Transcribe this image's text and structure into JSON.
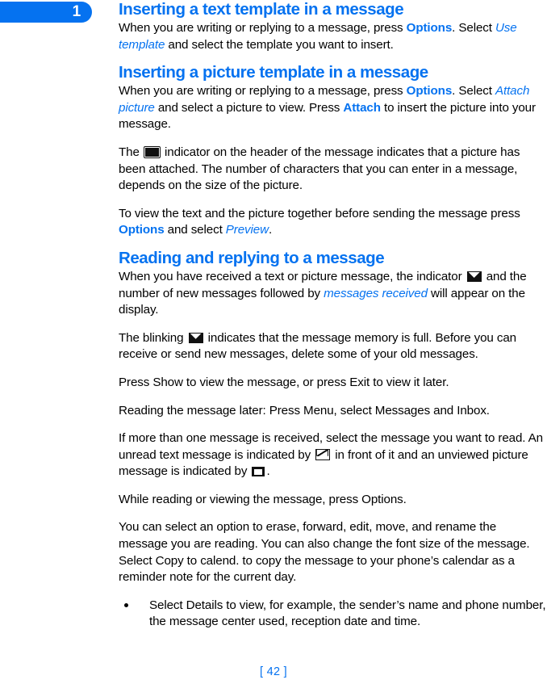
{
  "chapter_tab": {
    "number": "1",
    "color": "#0572f0"
  },
  "theme": {
    "accent": "#0572f0",
    "text": "#000000",
    "background": "#ffffff"
  },
  "sections": [
    {
      "heading": "Inserting a text template in a message",
      "paragraphs": [
        {
          "id": "p1",
          "runs": [
            {
              "text": "When you are writing or replying to a message, press ",
              "style": "plain"
            },
            {
              "text": "Options",
              "style": "blue-bold"
            },
            {
              "text": ". Select ",
              "style": "plain"
            },
            {
              "text": "Use template",
              "style": "blue-italic"
            },
            {
              "text": " and select the template you want to insert.",
              "style": "plain"
            }
          ]
        }
      ]
    },
    {
      "heading": "Inserting a picture template in a message",
      "paragraphs": [
        {
          "id": "p2",
          "runs": [
            {
              "text": "When you are writing or replying to a message, press ",
              "style": "plain"
            },
            {
              "text": "Options",
              "style": "blue-bold"
            },
            {
              "text": ". Select ",
              "style": "plain"
            },
            {
              "text": "Attach picture",
              "style": "blue-italic"
            },
            {
              "text": " and select a picture to view. Press ",
              "style": "plain"
            },
            {
              "text": "Attach",
              "style": "blue-bold"
            },
            {
              "text": " to insert the picture into your message.",
              "style": "plain"
            }
          ]
        },
        {
          "id": "p3",
          "lead": "The ",
          "icon": "picture-attached-icon",
          "tail": " indicator on the header of the message indicates that a picture has been attached. The number of characters that you can enter in a message, depends on the size of the picture."
        },
        {
          "id": "p4",
          "runs": [
            {
              "text": "To view the text and the picture together before sending the message press ",
              "style": "plain"
            },
            {
              "text": "Options",
              "style": "blue-bold"
            },
            {
              "text": " and select ",
              "style": "plain"
            },
            {
              "text": "Preview",
              "style": "blue-italic"
            },
            {
              "text": ".",
              "style": "plain"
            }
          ]
        }
      ]
    },
    {
      "heading": "Reading and replying to a message",
      "paragraphs": [
        {
          "id": "p5",
          "lead": "When you have received a text or picture message, the indicator ",
          "icon": "new-message-envelope-icon",
          "mid": " and the number of new messages followed by ",
          "emphasis": "messages received",
          "tail": " will appear on the display."
        },
        {
          "id": "p6",
          "lead": "The blinking ",
          "icon": "memory-full-envelope-icon",
          "tail": " indicates that the message memory is full. Before you can receive or send new messages, delete some of your old messages."
        },
        {
          "id": "p7",
          "text": "Press Show to view the message, or press Exit to view it later."
        },
        {
          "id": "p8",
          "text": "Reading the message later: Press Menu, select Messages and Inbox."
        },
        {
          "id": "p9",
          "lead": "If more than one message is received, select the message you want to read. An unread text message is indicated by ",
          "icon": "unread-text-envelope-icon",
          "mid": " in front of it and an unviewed picture message is indicated by ",
          "icon2": "unviewed-picture-icon",
          "tail": "."
        },
        {
          "id": "p10",
          "text": "While reading or viewing the message, press Options."
        },
        {
          "id": "p11",
          "text": "You can select an option to erase, forward, edit, move, and rename the message you are reading. You can also change the font size of the message. Select Copy to calend. to copy the message to your phone’s calendar as a reminder note for the current day."
        }
      ],
      "bullets": [
        "Select Details to view, for example, the sender’s name and phone number, the message center used, reception date and time."
      ]
    }
  ],
  "footer": {
    "page_number": "[ 42 ]"
  }
}
